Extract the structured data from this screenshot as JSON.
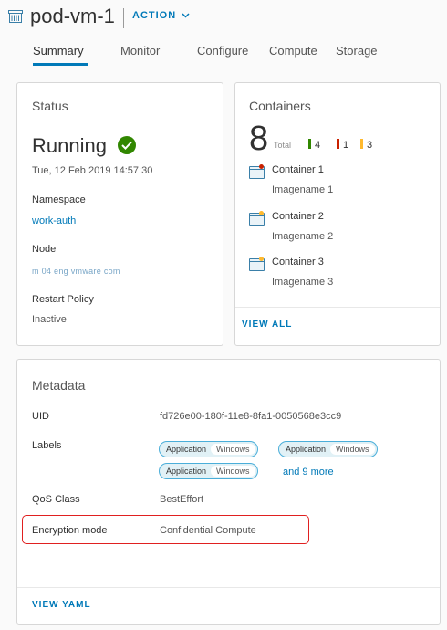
{
  "header": {
    "title": "pod-vm-1",
    "action_label": "ACTION"
  },
  "tabs": [
    {
      "label": "Summary",
      "active": true
    },
    {
      "label": "Monitor",
      "active": false
    },
    {
      "label": "Configure",
      "active": false
    },
    {
      "label": "Compute",
      "active": false
    },
    {
      "label": "Storage",
      "active": false
    }
  ],
  "status": {
    "title": "Status",
    "state": "Running",
    "timestamp": "Tue, 12 Feb 2019 14:57:30",
    "namespace_label": "Namespace",
    "namespace_value": "work-auth",
    "node_label": "Node",
    "node_value": "m 04 eng vmware com",
    "restart_label": "Restart Policy",
    "restart_value": "Inactive"
  },
  "containers": {
    "title": "Containers",
    "total": "8",
    "total_label": "Total",
    "counts": [
      {
        "value": "4",
        "color": "#318700"
      },
      {
        "value": "1",
        "color": "#c92100"
      },
      {
        "value": "3",
        "color": "#ffb92e"
      }
    ],
    "items": [
      {
        "name": "Container 1",
        "image": "Imagename 1",
        "dot": "#c92100"
      },
      {
        "name": "Container 2",
        "image": "Imagename 2",
        "dot": "#ffb92e"
      },
      {
        "name": "Container 3",
        "image": "Imagename 3",
        "dot": "#ffb92e"
      }
    ],
    "view_all": "VIEW ALL"
  },
  "metadata": {
    "title": "Metadata",
    "uid_label": "UID",
    "uid_value": "fd726e00-180f-11e8-8fa1-0050568e3cc9",
    "labels_label": "Labels",
    "labels": [
      {
        "key": "Application",
        "value": "Windows"
      },
      {
        "key": "Application",
        "value": "Windows"
      },
      {
        "key": "Application",
        "value": "Windows"
      }
    ],
    "more_labels": "and 9 more",
    "qos_label": "QoS Class",
    "qos_value": "BestEffort",
    "encryption_label": "Encryption mode",
    "encryption_value": "Confidential Compute",
    "view_yaml": "VIEW YAML"
  },
  "colors": {
    "accent": "#0079b8",
    "success": "#318700",
    "highlight": "#e02020"
  }
}
